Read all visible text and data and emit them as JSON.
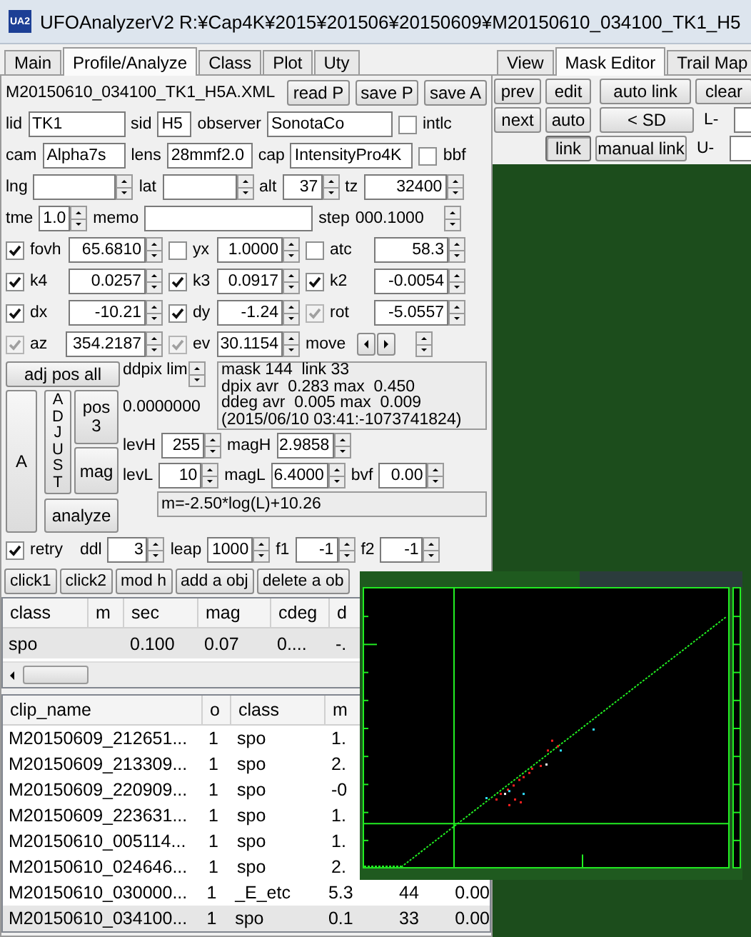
{
  "title_bar": {
    "icon_text": "UA2",
    "title": "UFOAnalyzerV2 R:¥Cap4K¥2015¥201506¥20150609¥M20150610_034100_TK1_H5"
  },
  "left_tabs": [
    {
      "label": "Main",
      "selected": false
    },
    {
      "label": "Profile/Analyze",
      "selected": true
    },
    {
      "label": "Class",
      "selected": false
    },
    {
      "label": "Plot",
      "selected": false
    },
    {
      "label": "Uty",
      "selected": false
    }
  ],
  "file_name": "M20150610_034100_TK1_H5A.XML",
  "file_buttons": [
    "read P",
    "save P",
    "save A"
  ],
  "form_rows": [
    [
      {
        "kind": "label",
        "text": "lid"
      },
      {
        "kind": "field",
        "value": "TK1"
      },
      {
        "kind": "label",
        "text": "sid"
      },
      {
        "kind": "field",
        "value": "H5"
      },
      {
        "kind": "label",
        "text": "observer"
      },
      {
        "kind": "field",
        "value": "SonotaCo"
      },
      {
        "kind": "check",
        "label": "intlc",
        "checked": false,
        "disabled": false
      }
    ],
    [
      {
        "kind": "label",
        "text": "cam"
      },
      {
        "kind": "field",
        "value": "Alpha7s"
      },
      {
        "kind": "label",
        "text": "lens"
      },
      {
        "kind": "field",
        "value": "28mmf2.0"
      },
      {
        "kind": "label",
        "text": "cap"
      },
      {
        "kind": "field",
        "value": "IntensityPro4K"
      },
      {
        "kind": "check",
        "label": "bbf",
        "checked": false,
        "disabled": false
      }
    ],
    [
      {
        "kind": "label",
        "text": "lng"
      },
      {
        "kind": "spin_field"
      },
      {
        "kind": "label",
        "text": "lat"
      },
      {
        "kind": "spin_field"
      },
      {
        "kind": "label",
        "text": "alt"
      },
      {
        "kind": "spin_field",
        "value": "37"
      },
      {
        "kind": "label",
        "text": "tz"
      },
      {
        "kind": "spin_field",
        "value": "32400"
      }
    ],
    [
      {
        "kind": "label",
        "text": "tme"
      },
      {
        "kind": "spin_field",
        "value": "1.0"
      },
      {
        "kind": "label",
        "text": "memo"
      },
      {
        "kind": "field"
      },
      {
        "kind": "label",
        "text": "step"
      },
      {
        "kind": "text",
        "text": "000.1000"
      },
      {
        "kind": "spinner"
      }
    ],
    [
      {
        "kind": "check",
        "label": "fovh",
        "checked": true,
        "disabled": false
      },
      {
        "kind": "spin_field",
        "value": "65.6810"
      },
      {
        "kind": "check",
        "label": "yx",
        "checked": false,
        "disabled": false
      },
      {
        "kind": "spin_field",
        "value": "1.0000"
      },
      {
        "kind": "check",
        "label": "atc",
        "checked": false,
        "disabled": false
      },
      {
        "kind": "spin_field",
        "value": "58.3"
      }
    ],
    [
      {
        "kind": "check",
        "label": "k4",
        "checked": true,
        "disabled": false
      },
      {
        "kind": "spin_field",
        "value": "0.0257"
      },
      {
        "kind": "check",
        "label": "k3",
        "checked": true,
        "disabled": false
      },
      {
        "kind": "spin_field",
        "value": "0.0917"
      },
      {
        "kind": "check",
        "label": "k2",
        "checked": true,
        "disabled": false
      },
      {
        "kind": "spin_field",
        "value": "-0.0054"
      }
    ],
    [
      {
        "kind": "check",
        "label": "dx",
        "checked": true,
        "disabled": false
      },
      {
        "kind": "spin_field",
        "value": "-10.21"
      },
      {
        "kind": "check",
        "label": "dy",
        "checked": true,
        "disabled": false
      },
      {
        "kind": "spin_field",
        "value": "-1.24"
      },
      {
        "kind": "check",
        "label": "rot",
        "checked": true,
        "disabled": true
      },
      {
        "kind": "spin_field",
        "value": "-5.0557"
      }
    ],
    [
      {
        "kind": "check",
        "label": "az",
        "checked": true,
        "disabled": true
      },
      {
        "kind": "spin_field",
        "value": "354.2187"
      },
      {
        "kind": "check",
        "label": "ev",
        "checked": true,
        "disabled": true
      },
      {
        "kind": "spin_field",
        "value": "30.1154"
      },
      {
        "kind": "label",
        "text": "move"
      },
      {
        "kind": "arrows"
      },
      {
        "kind": "spinner"
      }
    ]
  ],
  "adjust": {
    "adj_button": "adj pos all",
    "ddpix_label": "ddpix lim",
    "info_lines": [
      "mask 144  link 33",
      "dpix avr  0.283 max  0.450",
      "ddeg avr  0.005 max  0.009",
      "(2015/06/10 03:41:-1073741824)"
    ],
    "offset_value": "0.0000000",
    "a_button": "A",
    "adjust_button": "ADJUST",
    "pos_button": [
      "pos",
      "3"
    ],
    "mag_button": "mag",
    "analyze_button": "analyze"
  },
  "level_rows": [
    [
      {
        "kind": "label",
        "text": "levH"
      },
      {
        "kind": "spin_field",
        "value": "255"
      },
      {
        "kind": "label",
        "text": "magH"
      },
      {
        "kind": "spin_field",
        "value": "2.9858"
      }
    ],
    [
      {
        "kind": "label",
        "text": "levL"
      },
      {
        "kind": "spin_field",
        "value": "10"
      },
      {
        "kind": "label",
        "text": "magL"
      },
      {
        "kind": "spin_field",
        "value": "6.4000"
      },
      {
        "kind": "label",
        "text": "bvf"
      },
      {
        "kind": "spin_field",
        "value": "0.00"
      }
    ]
  ],
  "formula": "m=-2.50*log(L)+10.26",
  "retry_row": [
    {
      "kind": "check",
      "label": "retry",
      "checked": true,
      "disabled": false
    },
    {
      "kind": "label",
      "text": "ddl"
    },
    {
      "kind": "spin_field",
      "value": "3"
    },
    {
      "kind": "label",
      "text": "leap"
    },
    {
      "kind": "spin_field",
      "value": "1000"
    },
    {
      "kind": "label",
      "text": "f1"
    },
    {
      "kind": "spin_field",
      "value": "-1"
    },
    {
      "kind": "label",
      "text": "f2"
    },
    {
      "kind": "spin_field",
      "value": "-1"
    }
  ],
  "object_buttons": [
    "click1",
    "click2",
    "mod h",
    "add a obj",
    "delete a ob"
  ],
  "class_table": {
    "columns": [
      "class",
      "m",
      "sec",
      "mag",
      "cdeg",
      "d"
    ],
    "rows": [
      {
        "cells": [
          "spo",
          null,
          "0.100",
          "0.07",
          "0....",
          "-."
        ],
        "selected": true
      }
    ]
  },
  "clip_table": {
    "columns": [
      "clip_name",
      "o",
      "class",
      "m"
    ],
    "rows": [
      {
        "cells": [
          "M20150609_212651...",
          "1",
          "spo",
          "1."
        ],
        "selected": false
      },
      {
        "cells": [
          "M20150609_213309...",
          "1",
          "spo",
          "2."
        ],
        "selected": false
      },
      {
        "cells": [
          "M20150609_220909...",
          "1",
          "spo",
          "-0"
        ],
        "selected": false
      },
      {
        "cells": [
          "M20150609_223631...",
          "1",
          "spo",
          "1."
        ],
        "selected": false
      },
      {
        "cells": [
          "M20150610_005114...",
          "1",
          "spo",
          "1."
        ],
        "selected": false
      },
      {
        "cells": [
          "M20150610_024646...",
          "1",
          "spo",
          "2."
        ],
        "selected": false
      },
      {
        "cells": [
          "M20150610_030000...",
          "1",
          "_E_etc",
          "5.3",
          "44",
          "0.00"
        ],
        "selected": false
      },
      {
        "cells": [
          "M20150610_034100...",
          "1",
          "spo",
          "0.1",
          "33",
          "0.00"
        ],
        "selected": true
      }
    ]
  },
  "right_tabs": [
    {
      "label": "View",
      "selected": false
    },
    {
      "label": "Mask Editor",
      "selected": true
    },
    {
      "label": "Trail Map",
      "selected": false
    }
  ],
  "mask_rows": [
    [
      {
        "kind": "button",
        "text": "prev",
        "pressed": false
      },
      {
        "kind": "button",
        "text": "edit",
        "pressed": false
      },
      {
        "kind": "button",
        "text": "auto link",
        "pressed": false
      },
      {
        "kind": "button",
        "text": "clear",
        "pressed": false
      }
    ],
    [
      {
        "kind": "button",
        "text": "next",
        "pressed": false
      },
      {
        "kind": "button",
        "text": "auto",
        "pressed": false
      },
      {
        "kind": "button",
        "text": "< SD",
        "pressed": false
      },
      {
        "kind": "label",
        "text": "L-"
      },
      {
        "kind": "field"
      }
    ],
    [
      {
        "kind": "button",
        "text": "link",
        "pressed": true
      },
      {
        "kind": "button",
        "text": "manual link",
        "pressed": false
      },
      {
        "kind": "label",
        "text": "U-"
      },
      {
        "kind": "field"
      }
    ]
  ]
}
